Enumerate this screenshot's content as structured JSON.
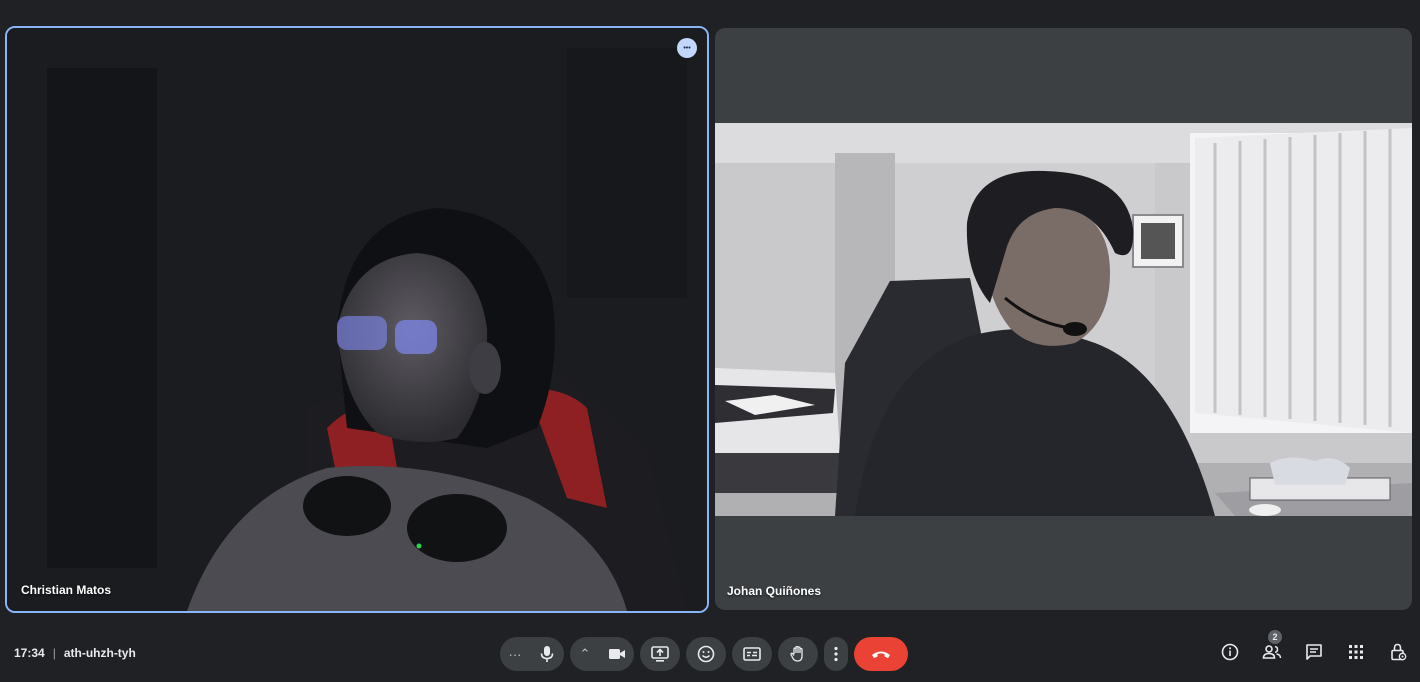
{
  "participants": [
    {
      "name": "Christian Matos",
      "speaking": true
    },
    {
      "name": "Johan Quiñones",
      "speaking": false
    }
  ],
  "tile_more_glyph": "•••",
  "meeting": {
    "time": "17:34",
    "separator": "|",
    "code": "ath-uhzh-tyh"
  },
  "controls": {
    "more_audio_glyph": "···",
    "more_video_glyph": "⌃",
    "icons": [
      "mic-icon",
      "videocam-icon",
      "present-screen-icon",
      "emoji-icon",
      "captions-icon",
      "raise-hand-icon",
      "more-vert-icon",
      "call-end-icon"
    ]
  },
  "right_panel": {
    "people_count": "2",
    "icons": [
      "info-icon",
      "people-icon",
      "chat-icon",
      "apps-icon",
      "host-controls-icon"
    ]
  },
  "colors": {
    "active_border": "#8ab4f8",
    "end_call": "#ea4335",
    "background": "#202124",
    "tile": "#3c4043"
  }
}
